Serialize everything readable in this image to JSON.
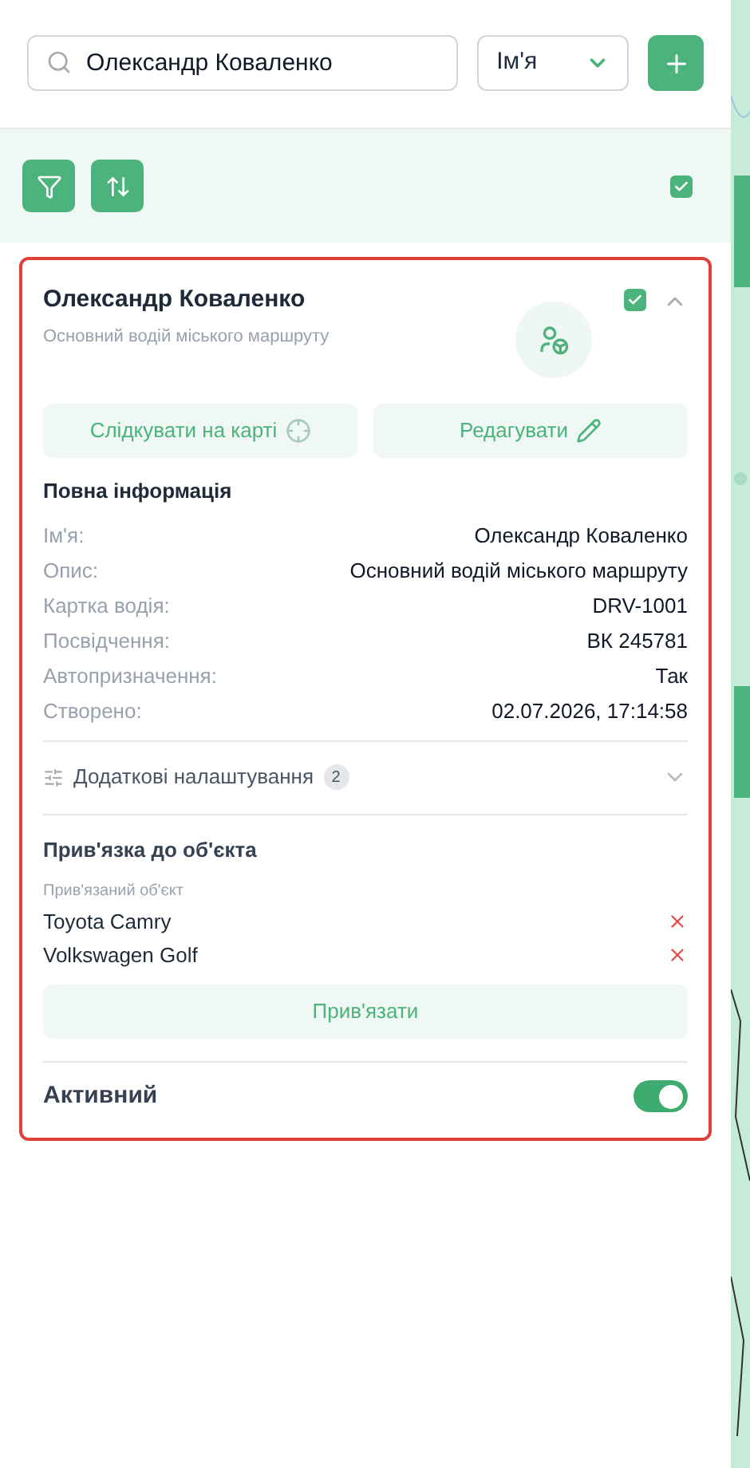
{
  "search": {
    "value": "Олександр Коваленко"
  },
  "search_by": {
    "value": "Ім'я"
  },
  "toolbar": {
    "select_all_checked": true
  },
  "card": {
    "selected": true,
    "name": "Олександр Коваленко",
    "description": "Основний водій міського маршруту",
    "checked": true,
    "expanded": true,
    "actions": [
      {
        "kind": "track",
        "label": "Слідкувати на карті"
      },
      {
        "kind": "edit",
        "label": "Редагувати"
      }
    ],
    "info_title": "Повна інформація",
    "info": [
      {
        "label": "Ім'я:",
        "value": "Олександр Коваленко"
      },
      {
        "label": "Опис:",
        "value": "Основний водій міського маршруту"
      },
      {
        "label": "Картка водія:",
        "value": "DRV-1001"
      },
      {
        "label": "Посвідчення:",
        "value": "ВК 245781"
      },
      {
        "label": "Автопризначення:",
        "value": "Так"
      },
      {
        "label": "Створено:",
        "value": "02.07.2026, 17:14:58"
      }
    ],
    "extra_settings": {
      "label": "Додаткові налаштування",
      "count": "2",
      "expanded": false
    },
    "binding": {
      "title": "Прив'язка до об'єкта",
      "subtitle": "Прив'язаний об'єкт",
      "objects": [
        "Toyota Camry",
        "Volkswagen Golf"
      ],
      "button": "Прив'язати"
    },
    "active": {
      "label": "Активний",
      "on": true
    }
  }
}
